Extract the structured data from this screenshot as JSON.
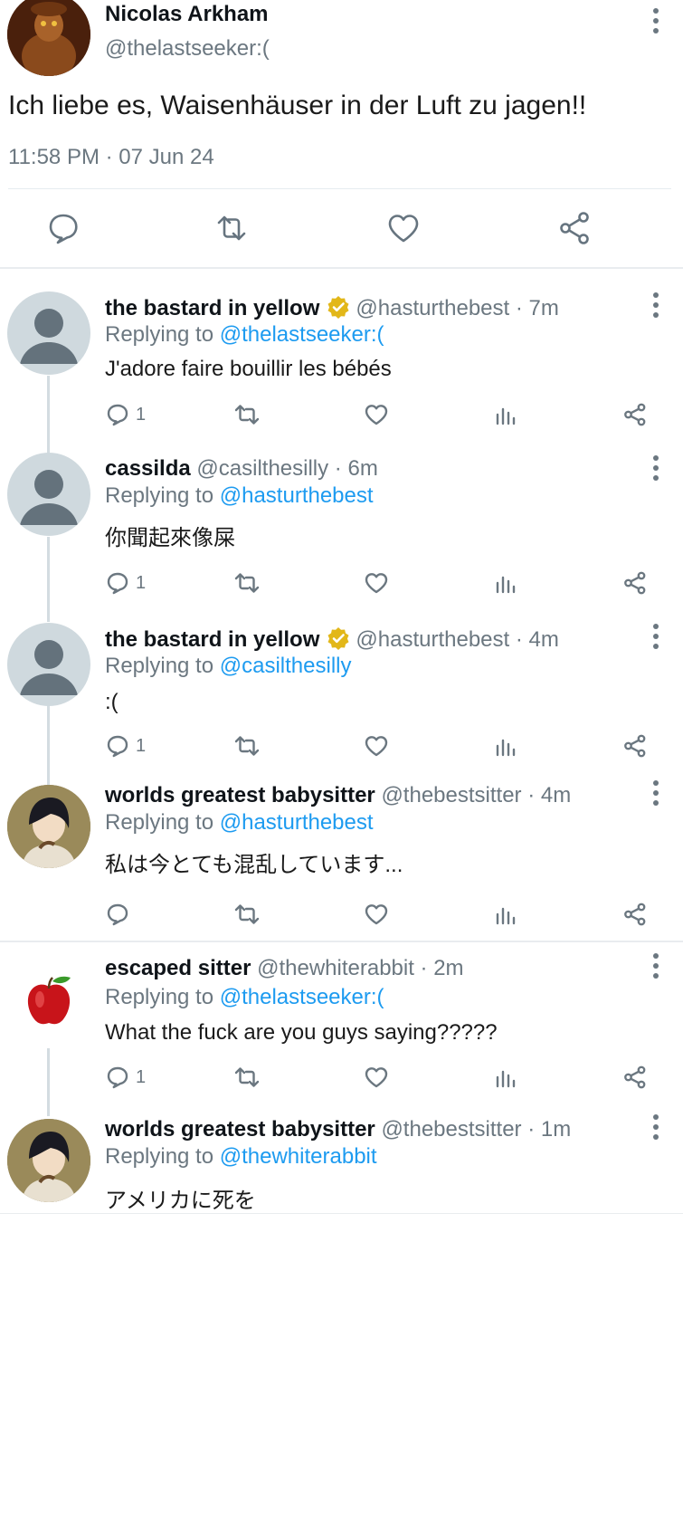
{
  "main_tweet": {
    "name": "Nicolas Arkham",
    "handle": "@thelastseeker:(",
    "text": "Ich liebe es, Waisenhäuser in der Luft zu jagen!!",
    "time": "11:58 PM · 07 Jun 24"
  },
  "replies": [
    {
      "name": "the bastard in yellow",
      "verified": true,
      "meta": "@hasturthebest · 7m",
      "replying_prefix": "Replying to ",
      "replying_to": "@thelastseeker:(",
      "text": "J'adore faire bouillir les bébés",
      "reply_count": "1",
      "avatar": "default-avatar"
    },
    {
      "name": "cassilda",
      "verified": false,
      "meta": "@casilthesilly · 6m",
      "replying_prefix": "Replying to ",
      "replying_to": "@hasturthebest",
      "text": "你聞起來像屎",
      "reply_count": "1",
      "avatar": "default-avatar"
    },
    {
      "name": "the bastard in yellow",
      "verified": true,
      "meta": "@hasturthebest · 4m",
      "replying_prefix": "Replying to ",
      "replying_to": "@casilthesilly",
      "text": ":(",
      "reply_count": "1",
      "avatar": "default-avatar"
    },
    {
      "name": "worlds greatest babysitter",
      "verified": false,
      "meta": "@thebestsitter · 4m",
      "replying_prefix": "Replying to ",
      "replying_to": "@hasturthebest",
      "text": "私は今とても混乱しています...",
      "reply_count": "",
      "avatar": "anime-avatar"
    },
    {
      "name": "escaped sitter",
      "verified": false,
      "meta": "@thewhiterabbit · 2m",
      "replying_prefix": "Replying to ",
      "replying_to": "@thelastseeker:(",
      "text": "What the fuck are you guys saying?????",
      "reply_count": "1",
      "avatar": "apple-avatar"
    },
    {
      "name": "worlds greatest babysitter",
      "verified": false,
      "meta": "@thebestsitter · 1m",
      "replying_prefix": "Replying to ",
      "replying_to": "@thewhiterabbit",
      "text": "アメリカに死を",
      "reply_count": "",
      "avatar": "anime-avatar"
    }
  ],
  "colors": {
    "link": "#1d9bf0",
    "muted": "#6b7780",
    "verified_badge": "#e2b719"
  }
}
